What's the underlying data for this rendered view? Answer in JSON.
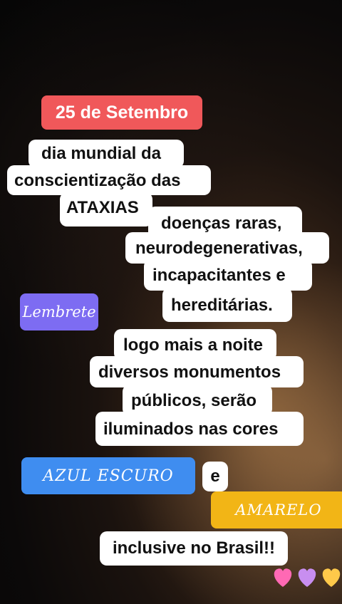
{
  "date_label": "25 de Setembro",
  "block1": {
    "line1": "dia mundial da",
    "line2": "conscientização das",
    "line3": "ATAXIAS"
  },
  "block2": {
    "line1": "doenças raras,",
    "line2": "neurodegenerativas,",
    "line3": "incapacitantes e",
    "line4": "hereditárias."
  },
  "reminder": "Lembrete",
  "block3": {
    "line1": "logo mais a noite",
    "line2": "diversos monumentos",
    "line3": "públicos, serão",
    "line4": "iluminados nas cores"
  },
  "color1": "AZUL ESCURO",
  "conj": "e",
  "color2": "AMARELO",
  "final": "inclusive no Brasil!!",
  "colors": {
    "date_bg": "#f0585a",
    "reminder_bg": "#7d6cf2",
    "blue_tag": "#3f8df0",
    "yellow_tag": "#f2b516"
  },
  "hearts": [
    "pink-heart",
    "purple-heart",
    "yellow-heart"
  ]
}
